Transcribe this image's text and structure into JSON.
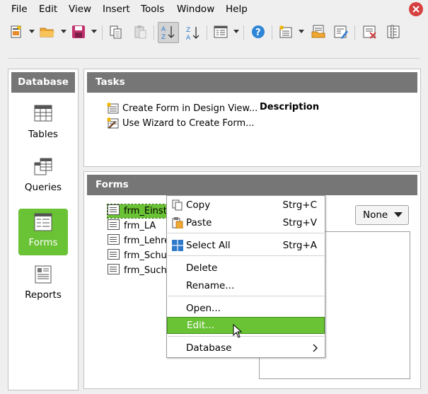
{
  "menubar": {
    "items": [
      "File",
      "Edit",
      "View",
      "Insert",
      "Tools",
      "Window",
      "Help"
    ]
  },
  "toolbar": {
    "icons": [
      "new-document-icon",
      "open-folder-icon",
      "save-icon",
      "copy-icon",
      "paste-icon",
      "sort-ascending-icon",
      "sort-descending-icon",
      "form-icon",
      "help-icon",
      "new-form-icon",
      "open-form-icon",
      "edit-form-icon",
      "delete-form-icon",
      "properties-icon"
    ]
  },
  "database_panel": {
    "title": "Database",
    "items": [
      {
        "label": "Tables",
        "icon": "tables-icon"
      },
      {
        "label": "Queries",
        "icon": "queries-icon"
      },
      {
        "label": "Forms",
        "icon": "forms-icon"
      },
      {
        "label": "Reports",
        "icon": "reports-icon"
      }
    ]
  },
  "tasks_panel": {
    "title": "Tasks",
    "tasks": [
      "Create Form in Design View...",
      "Use Wizard to Create Form..."
    ],
    "description_label": "Description"
  },
  "forms_panel": {
    "title": "Forms",
    "items": [
      "frm_Einste",
      "frm_LA",
      "frm_Lehre",
      "frm_Schule",
      "frm_Suche"
    ],
    "preview_value": "None"
  },
  "context_menu": {
    "items": [
      {
        "label": "Copy",
        "shortcut": "Strg+C"
      },
      {
        "label": "Paste",
        "shortcut": "Strg+V"
      },
      {
        "label": "Select All",
        "shortcut": "Strg+A"
      },
      {
        "label": "Delete"
      },
      {
        "label": "Rename..."
      },
      {
        "label": "Open..."
      },
      {
        "label": "Edit..."
      },
      {
        "label": "Database"
      }
    ]
  },
  "colors": {
    "accent_green": "#6ac235",
    "panel_header": "#767676",
    "close_red": "#d64040"
  }
}
